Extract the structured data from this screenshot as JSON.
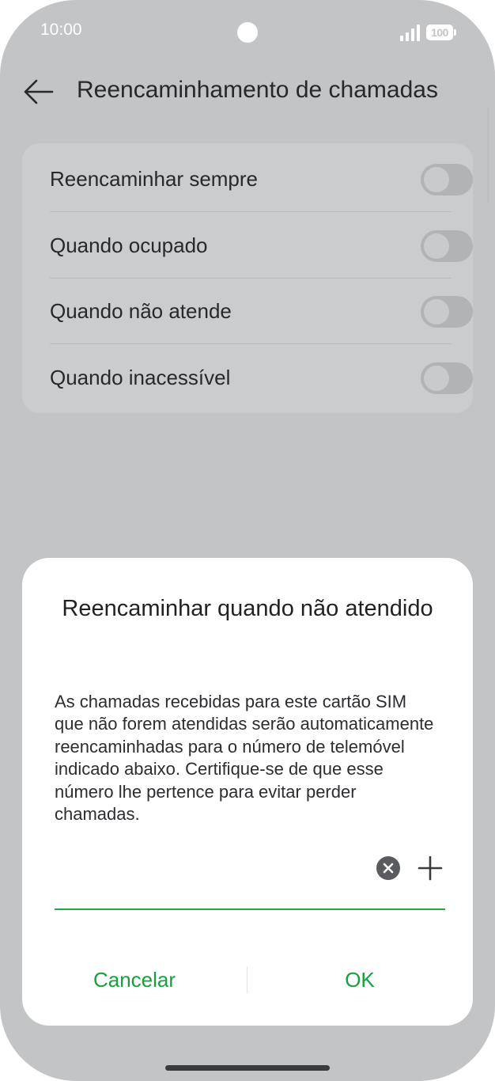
{
  "status_bar": {
    "time": "10:00",
    "battery": "100",
    "icons": [
      "camera-dot",
      "signal-icon",
      "battery-icon"
    ]
  },
  "header": {
    "back_icon": "back-arrow-icon",
    "title": "Reencaminhamento de chamadas"
  },
  "settings": {
    "items": [
      {
        "label": "Reencaminhar sempre",
        "enabled": false
      },
      {
        "label": "Quando ocupado",
        "enabled": false
      },
      {
        "label": "Quando não atende",
        "enabled": false
      },
      {
        "label": "Quando inacessível",
        "enabled": false
      }
    ]
  },
  "dialog": {
    "title": "Reencaminhar quando não atendido",
    "body": "As chamadas recebidas para este cartão SIM que não forem atendidas serão automaticamente reencaminhadas para o número de telemóvel indicado abaixo. Certifique-se de que esse número lhe pertence para evitar perder chamadas.",
    "phone_value": "",
    "clear_icon": "clear-icon",
    "add_icon": "add-contact-icon",
    "cancel_label": "Cancelar",
    "ok_label": "OK"
  },
  "colors": {
    "scrim_background": "#c3c4c6",
    "card_background": "#cbccce",
    "accent_green": "#17a03c",
    "underline_green": "#22a447",
    "text_dark": "#26282b"
  }
}
